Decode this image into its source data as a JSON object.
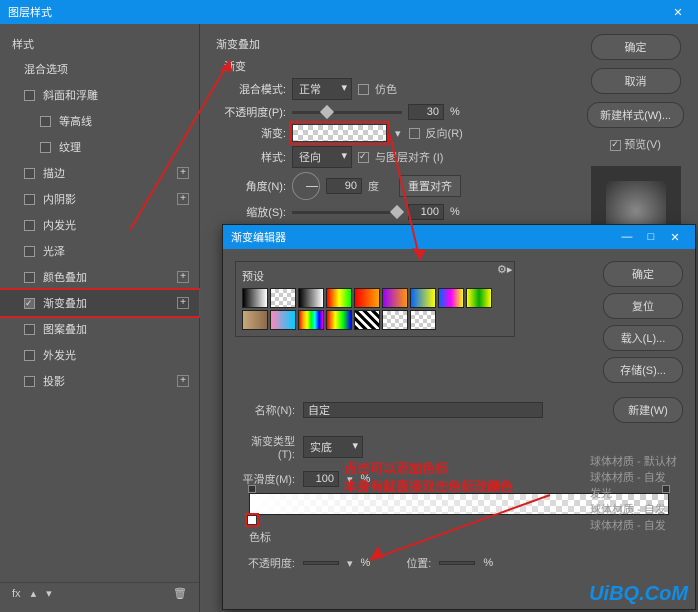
{
  "window": {
    "title": "图层样式",
    "close": "✕"
  },
  "left": {
    "styles_label": "样式",
    "blend_label": "混合选项",
    "items": [
      {
        "label": "斜面和浮雕",
        "plus": false
      },
      {
        "label": "等高线",
        "sub": true
      },
      {
        "label": "纹理",
        "sub": true
      },
      {
        "label": "描边",
        "plus": true
      },
      {
        "label": "内阴影",
        "plus": true
      },
      {
        "label": "内发光"
      },
      {
        "label": "光泽"
      },
      {
        "label": "颜色叠加",
        "plus": true
      },
      {
        "label": "渐变叠加",
        "plus": true,
        "checked": true,
        "active": true
      },
      {
        "label": "图案叠加"
      },
      {
        "label": "外发光"
      },
      {
        "label": "投影",
        "plus": true
      }
    ],
    "footer_fx": "fx"
  },
  "panel": {
    "title": "渐变叠加",
    "subtitle": "渐变",
    "blend_mode_label": "混合模式:",
    "blend_mode_value": "正常",
    "dither_label": "仿色",
    "opacity_label": "不透明度(P):",
    "opacity_value": "30",
    "pct": "%",
    "gradient_label": "渐变:",
    "reverse_label": "反向(R)",
    "style_label": "样式:",
    "style_value": "径向",
    "align_label": "与图层对齐 (I)",
    "align_checked": true,
    "angle_label": "角度(N):",
    "angle_value": "90",
    "degree": "度",
    "reset_align": "重置对齐",
    "scale_label": "缩放(S):",
    "scale_value": "100"
  },
  "buttons": {
    "ok": "确定",
    "cancel": "取消",
    "new_style": "新建样式(W)...",
    "preview": "预览(V)"
  },
  "ge": {
    "title": "渐变编辑器",
    "min": "—",
    "max": "□",
    "close": "✕",
    "presets_label": "预设",
    "ok": "确定",
    "reset": "复位",
    "load": "载入(L)...",
    "save": "存储(S)...",
    "new": "新建(W)",
    "name_label": "名称(N):",
    "name_value": "自定",
    "type_label": "渐变类型(T):",
    "type_value": "实底",
    "smooth_label": "平滑度(M):",
    "smooth_value": "100",
    "pct": "%",
    "stops_label": "色标",
    "opacity_label": "不透明度:",
    "pos_label": "位置:"
  },
  "annot": {
    "line1": "点击可以添加色标",
    "line2": "本身有就直接双击色标改颜色"
  },
  "watermark": "UiBQ.CoM",
  "bg": {
    "l1": "球体材质 - 默认材",
    "l2": "球体材质 - 自发",
    "l3": "发光",
    "l4": "球体材质 - 自发",
    "l5": "球体材质 - 自发"
  }
}
